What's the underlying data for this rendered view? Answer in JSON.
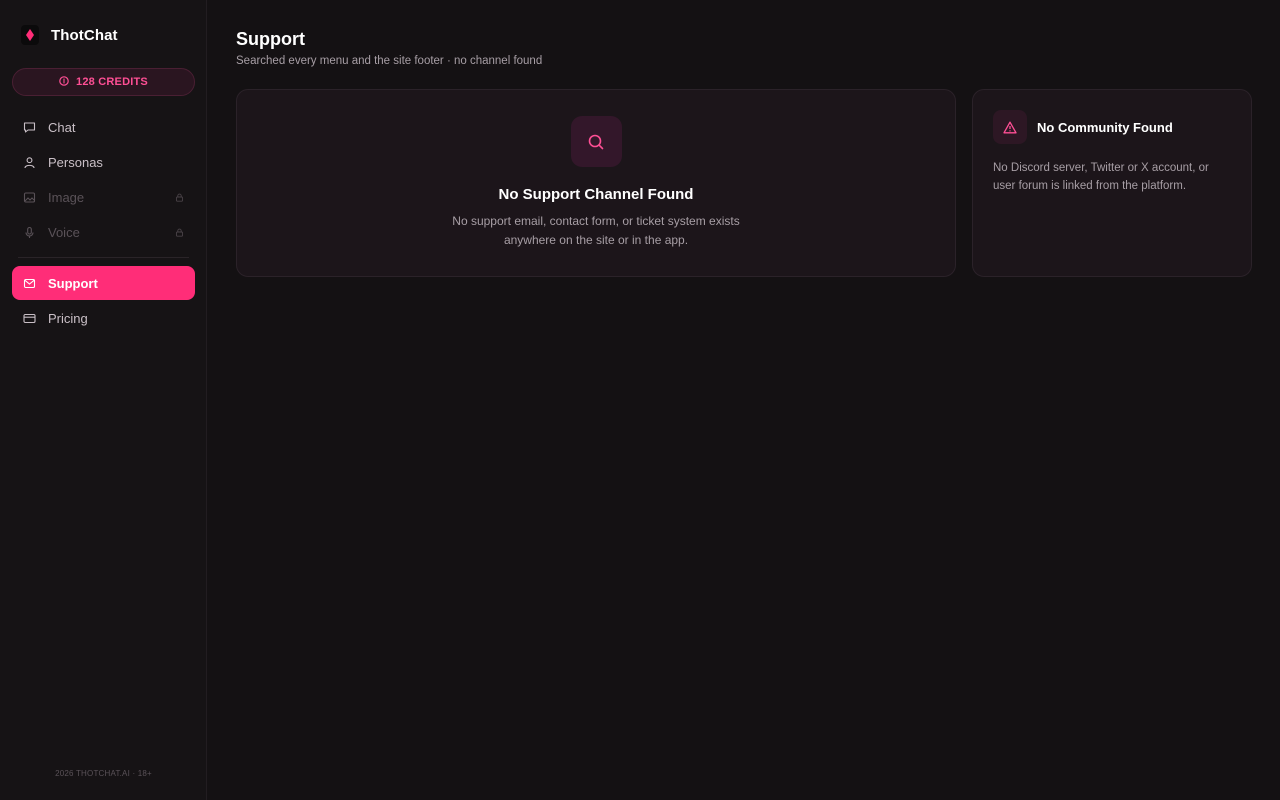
{
  "brand": {
    "name": "ThotChat"
  },
  "credits": {
    "label": "128 CREDITS"
  },
  "nav": {
    "items": [
      {
        "label": "Chat",
        "icon": "chat-bubble-icon"
      },
      {
        "label": "Personas",
        "icon": "user-icon"
      },
      {
        "label": "Image",
        "icon": "image-icon",
        "locked": true
      },
      {
        "label": "Voice",
        "icon": "microphone-icon",
        "locked": true
      },
      {
        "label": "Support",
        "icon": "mail-icon",
        "active": true
      },
      {
        "label": "Pricing",
        "icon": "credit-card-icon"
      }
    ]
  },
  "footer": {
    "text": "2026 THOTCHAT.AI · 18+"
  },
  "page": {
    "title": "Support",
    "subtitle": "Searched every menu and the site footer · no channel found"
  },
  "main_card": {
    "title": "No Support Channel Found",
    "body": "No support email, contact form, or ticket system exists anywhere on the site or in the app."
  },
  "side_card": {
    "title": "No Community Found",
    "body": "No Discord server, Twitter or X account, or user forum is linked from the platform."
  },
  "colors": {
    "accent": "#ff2d78",
    "background": "#141113",
    "card": "#1c151a"
  }
}
